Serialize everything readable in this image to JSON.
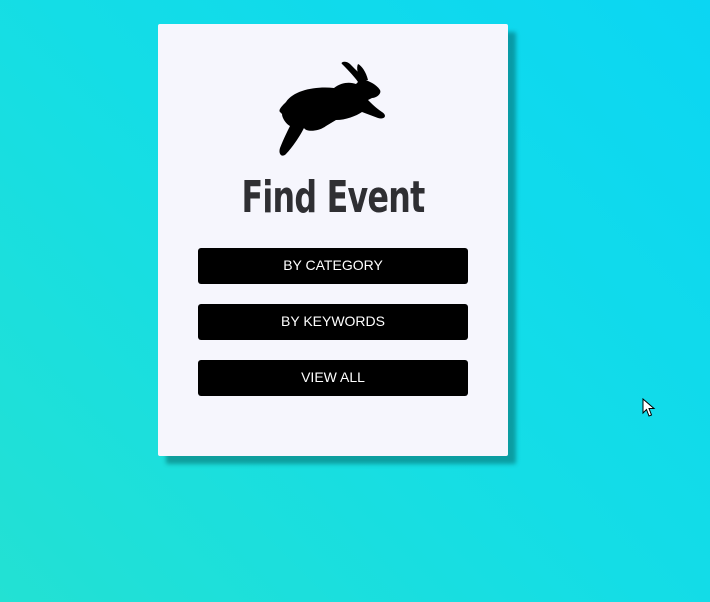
{
  "card": {
    "title": "Find Event",
    "logo_icon": "jumping-rabbit-icon"
  },
  "buttons": {
    "by_category": "BY CATEGORY",
    "by_keywords": "BY KEYWORDS",
    "view_all": "VIEW ALL"
  },
  "colors": {
    "background_gradient": [
      "#0bd6f3",
      "#23e1d3"
    ],
    "card_background": "#f6f6fd",
    "button_background": "#000000",
    "button_text": "#ffffff",
    "title_text": "#2f2f33"
  }
}
